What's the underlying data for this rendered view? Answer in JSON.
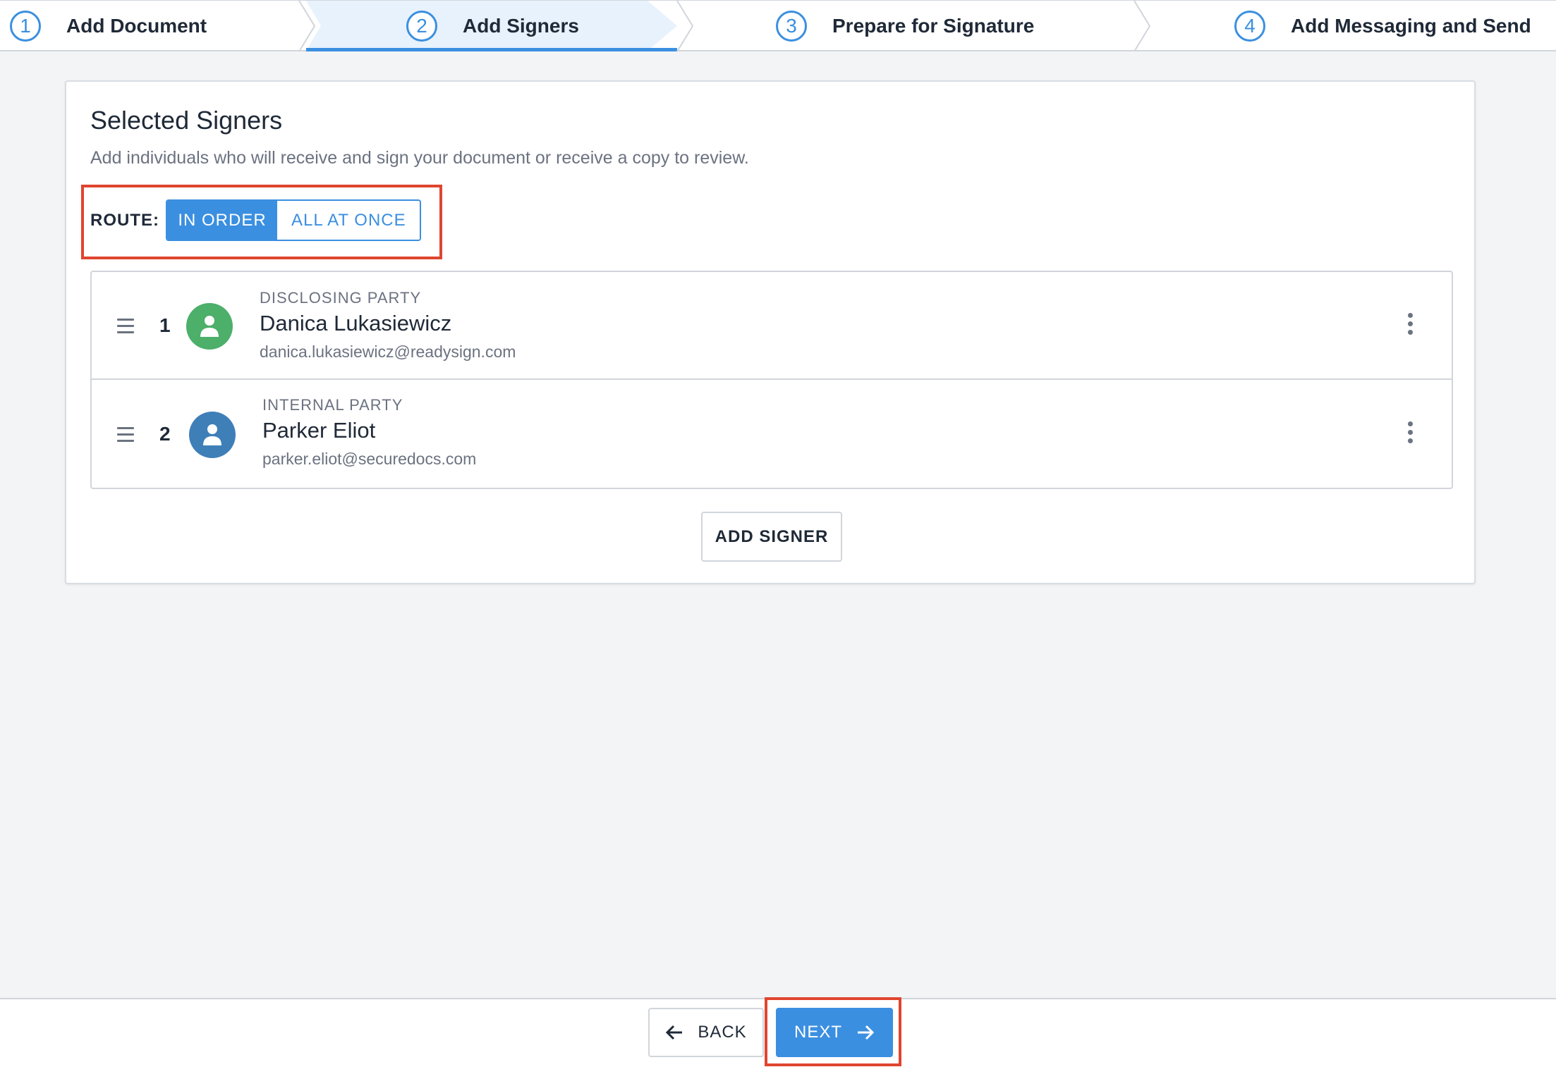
{
  "stepper": {
    "steps": [
      {
        "number": "1",
        "label": "Add Document"
      },
      {
        "number": "2",
        "label": "Add Signers"
      },
      {
        "number": "3",
        "label": "Prepare for Signature"
      },
      {
        "number": "4",
        "label": "Add Messaging and Send"
      }
    ],
    "active_step": "2"
  },
  "card": {
    "title": "Selected Signers",
    "subtitle": "Add individuals who will receive and sign your document or receive a copy to review.",
    "route": {
      "label": "ROUTE:",
      "options": [
        "IN ORDER",
        "ALL AT ONCE"
      ],
      "selected": "IN ORDER"
    },
    "signers": [
      {
        "order": "1",
        "role": "DISCLOSING PARTY",
        "name": "Danica Lukasiewicz",
        "email": "danica.lukasiewicz@readysign.com",
        "avatar_color": "#4caf6a"
      },
      {
        "order": "2",
        "role": "INTERNAL PARTY",
        "name": "Parker Eliot",
        "email": "parker.eliot@securedocs.com",
        "avatar_color": "#3f7fb8"
      }
    ],
    "add_signer_label": "ADD SIGNER"
  },
  "footer": {
    "back_label": "BACK",
    "next_label": "NEXT"
  },
  "colors": {
    "accent": "#3b8fe0",
    "highlight": "#e0452f"
  },
  "icons": [
    "drag-handle-icon",
    "user-icon",
    "more-vertical-icon",
    "arrow-left-icon",
    "arrow-right-icon"
  ]
}
